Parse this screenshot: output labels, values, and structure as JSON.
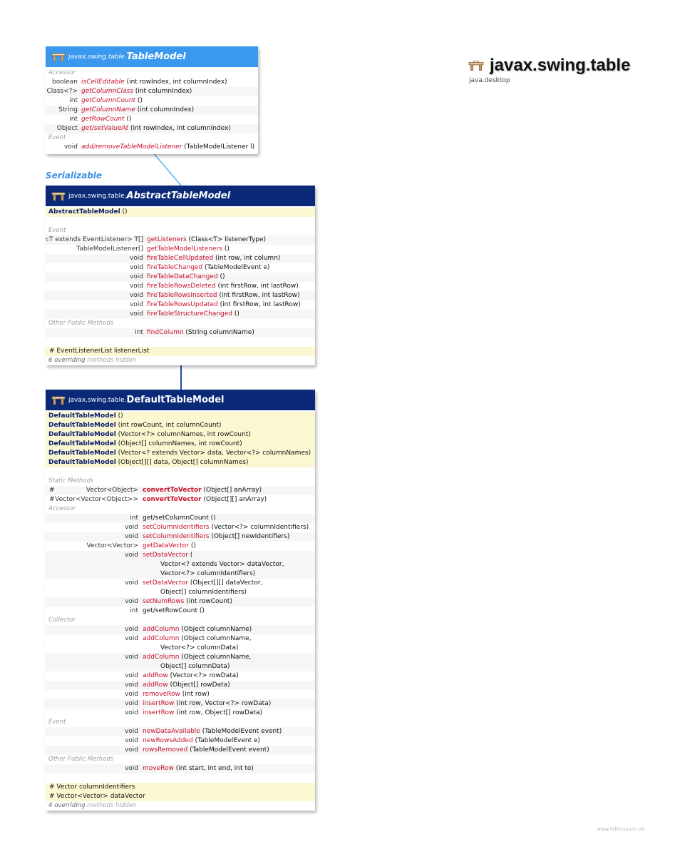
{
  "package": {
    "name": "javax.swing.table",
    "module": "java.desktop"
  },
  "footer": "www.falkhausen.de",
  "relation_label": "Serializable",
  "colors": {
    "interface_header": "#3a99ee",
    "class_header": "#0a2a78",
    "highlight_row": "#fbf7d0",
    "method": "#c8102e",
    "type": "#1e3c8c",
    "interface_link": "#58b8f0",
    "inheritance_link": "#1e4fa0"
  },
  "table_model": {
    "package": "javax.swing.table.",
    "name": "TableModel",
    "sections": [
      {
        "title": "Accessor"
      },
      {
        "type": "boolean",
        "method": "isCellEditable",
        "params": " (int rowIndex, int columnIndex)"
      },
      {
        "type": "Class<?>",
        "method": "getColumnClass",
        "params": " (int columnIndex)"
      },
      {
        "type": "int",
        "method": "getColumnCount",
        "params": " ()"
      },
      {
        "type": "String",
        "method": "getColumnName",
        "params": " (int columnIndex)"
      },
      {
        "type": "int",
        "method": "getRowCount",
        "params": " ()"
      },
      {
        "type": "Object",
        "method": "get/setValueAt",
        "params": " (int rowIndex, int columnIndex)"
      },
      {
        "title": "Event"
      },
      {
        "type": "void",
        "method": "add/removeTableModelListener",
        "params": " (TableModelListener l)"
      }
    ]
  },
  "abstract_table_model": {
    "package": "javax.swing.table.",
    "name": "AbstractTableModel",
    "rows": [
      {
        "kind": "ctor",
        "text": "AbstractTableModel",
        "params": " ()"
      },
      {
        "kind": "gap"
      },
      {
        "kind": "sec",
        "text": "Event"
      },
      {
        "kind": "m",
        "type": "<T extends EventListener> T[]",
        "method": "getListeners",
        "params": " (Class<T> listenerType)"
      },
      {
        "kind": "m",
        "type": "TableModelListener[]",
        "method": "getTableModelListeners",
        "params": " ()"
      },
      {
        "kind": "m",
        "type": "void",
        "method": "fireTableCellUpdated",
        "params": " (int row, int column)"
      },
      {
        "kind": "m",
        "type": "void",
        "method": "fireTableChanged",
        "params": " (TableModelEvent e)"
      },
      {
        "kind": "m",
        "type": "void",
        "method": "fireTableDataChanged",
        "params": " ()"
      },
      {
        "kind": "m",
        "type": "void",
        "method": "fireTableRowsDeleted",
        "params": " (int firstRow, int lastRow)"
      },
      {
        "kind": "m",
        "type": "void",
        "method": "fireTableRowsInserted",
        "params": " (int firstRow, int lastRow)"
      },
      {
        "kind": "m",
        "type": "void",
        "method": "fireTableRowsUpdated",
        "params": " (int firstRow, int lastRow)"
      },
      {
        "kind": "m",
        "type": "void",
        "method": "fireTableStructureChanged",
        "params": " ()"
      },
      {
        "kind": "sec",
        "text": "Other Public Methods"
      },
      {
        "kind": "m",
        "type": "int",
        "method": "findColumn",
        "params": " (String columnName)"
      },
      {
        "kind": "gap"
      },
      {
        "kind": "field",
        "text": "# EventListenerList listenerList"
      }
    ],
    "hidden_count": "6 overriding",
    "hidden_rest": " methods hidden"
  },
  "default_table_model": {
    "package": "javax.swing.table.",
    "name": "DefaultTableModel",
    "rows": [
      {
        "kind": "ctor",
        "text": "DefaultTableModel",
        "params": " ()"
      },
      {
        "kind": "ctor",
        "text": "DefaultTableModel",
        "params": " (int rowCount, int columnCount)"
      },
      {
        "kind": "ctor",
        "text": "DefaultTableModel",
        "params": " (Vector<?> columnNames, int rowCount)"
      },
      {
        "kind": "ctor",
        "text": "DefaultTableModel",
        "params": " (Object[] columnNames, int rowCount)"
      },
      {
        "kind": "ctor",
        "text": "DefaultTableModel",
        "params": " (Vector<? extends Vector> data, Vector<?> columnNames)"
      },
      {
        "kind": "ctor",
        "text": "DefaultTableModel",
        "params": " (Object[][] data, Object[] columnNames)"
      },
      {
        "kind": "gap"
      },
      {
        "kind": "sec",
        "text": "Static Methods"
      },
      {
        "kind": "ms",
        "prefix": "#",
        "type": "Vector<Object>",
        "method": "convertToVector",
        "params": " (Object[] anArray)"
      },
      {
        "kind": "ms",
        "prefix": "#",
        "type": "Vector<Vector<Object>>",
        "method": "convertToVector",
        "params": " (Object[][] anArray)"
      },
      {
        "kind": "sec",
        "text": "Accessor"
      },
      {
        "kind": "m",
        "type": "int",
        "method": "get/setColumnCount",
        "params": " ()",
        "plain": true
      },
      {
        "kind": "m",
        "type": "void",
        "method": "setColumnIdentifiers",
        "params": " (Vector<?> columnIdentifiers)"
      },
      {
        "kind": "m",
        "type": "void",
        "method": "setColumnIdentifiers",
        "params": " (Object[] newIdentifiers)"
      },
      {
        "kind": "m",
        "type": "Vector<Vector>",
        "method": "getDataVector",
        "params": " ()"
      },
      {
        "kind": "m",
        "type": "void",
        "method": "setDataVector",
        "params": " ("
      },
      {
        "kind": "cont",
        "text": "Vector<? extends Vector> dataVector,"
      },
      {
        "kind": "cont",
        "text": "Vector<?> columnIdentifiers)"
      },
      {
        "kind": "m",
        "type": "void",
        "method": "setDataVector",
        "params": " (Object[][] dataVector,"
      },
      {
        "kind": "cont",
        "text": "Object[] columnIdentifiers)"
      },
      {
        "kind": "m",
        "type": "void",
        "method": "setNumRows",
        "params": " (int rowCount)"
      },
      {
        "kind": "m",
        "type": "int",
        "method": "get/setRowCount",
        "params": " ()",
        "plain": true
      },
      {
        "kind": "sec",
        "text": "Collector"
      },
      {
        "kind": "m",
        "type": "void",
        "method": "addColumn",
        "params": " (Object columnName)"
      },
      {
        "kind": "m",
        "type": "void",
        "method": "addColumn",
        "params": " (Object columnName,"
      },
      {
        "kind": "cont",
        "text": "Vector<?> columnData)"
      },
      {
        "kind": "m",
        "type": "void",
        "method": "addColumn",
        "params": " (Object columnName,"
      },
      {
        "kind": "cont",
        "text": "Object[] columnData)"
      },
      {
        "kind": "m",
        "type": "void",
        "method": "addRow",
        "params": " (Vector<?> rowData)"
      },
      {
        "kind": "m",
        "type": "void",
        "method": "addRow",
        "params": " (Object[] rowData)"
      },
      {
        "kind": "m",
        "type": "void",
        "method": "removeRow",
        "params": " (int row)"
      },
      {
        "kind": "m",
        "type": "void",
        "method": "insertRow",
        "params": " (int row, Vector<?> rowData)"
      },
      {
        "kind": "m",
        "type": "void",
        "method": "insertRow",
        "params": " (int row, Object[] rowData)"
      },
      {
        "kind": "sec",
        "text": "Event"
      },
      {
        "kind": "m",
        "type": "void",
        "method": "newDataAvailable",
        "params": " (TableModelEvent event)"
      },
      {
        "kind": "m",
        "type": "void",
        "method": "newRowsAdded",
        "params": " (TableModelEvent e)"
      },
      {
        "kind": "m",
        "type": "void",
        "method": "rowsRemoved",
        "params": " (TableModelEvent event)"
      },
      {
        "kind": "sec",
        "text": "Other Public Methods"
      },
      {
        "kind": "m",
        "type": "void",
        "method": "moveRow",
        "params": " (int start, int end, int to)"
      },
      {
        "kind": "gap"
      },
      {
        "kind": "field",
        "text": "# Vector columnIdentifiers"
      },
      {
        "kind": "field",
        "text": "# Vector<Vector> dataVector"
      }
    ],
    "hidden_count": "4 overriding",
    "hidden_rest": " methods hidden"
  }
}
